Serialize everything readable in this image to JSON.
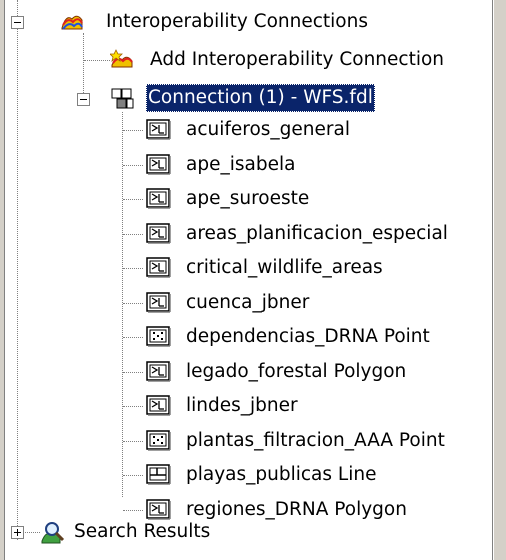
{
  "tree": {
    "root": {
      "label": "Interoperability Connections",
      "icon": "interoperability-icon",
      "expanded": true
    },
    "add_connection": {
      "label": "Add Interoperability Connection",
      "icon": "add-connection-icon"
    },
    "connection": {
      "label": "Connection (1) -  WFS.fdl",
      "icon": "connection-icon",
      "selected": true,
      "expanded": true
    },
    "layers": [
      {
        "label": "acuiferos_general",
        "icon": "raster-layer-icon"
      },
      {
        "label": "ape_isabela",
        "icon": "raster-layer-icon"
      },
      {
        "label": "ape_suroeste",
        "icon": "raster-layer-icon"
      },
      {
        "label": "areas_planificacion_especial",
        "icon": "raster-layer-icon"
      },
      {
        "label": "critical_wildlife_areas",
        "icon": "raster-layer-icon"
      },
      {
        "label": "cuenca_jbner",
        "icon": "raster-layer-icon"
      },
      {
        "label": "dependencias_DRNA Point",
        "icon": "point-layer-icon"
      },
      {
        "label": "legado_forestal Polygon",
        "icon": "raster-layer-icon"
      },
      {
        "label": "lindes_jbner",
        "icon": "raster-layer-icon"
      },
      {
        "label": "plantas_filtracion_AAA Point",
        "icon": "point-layer-icon"
      },
      {
        "label": "playas_publicas Line",
        "icon": "line-layer-icon"
      },
      {
        "label": "regiones_DRNA Polygon",
        "icon": "raster-layer-icon"
      }
    ],
    "search_results": {
      "label": "Search Results",
      "icon": "search-results-icon",
      "expanded": false
    }
  },
  "colors": {
    "selection": "#0a246a",
    "frame": "#d4d0c8",
    "tree_line": "#808080"
  }
}
